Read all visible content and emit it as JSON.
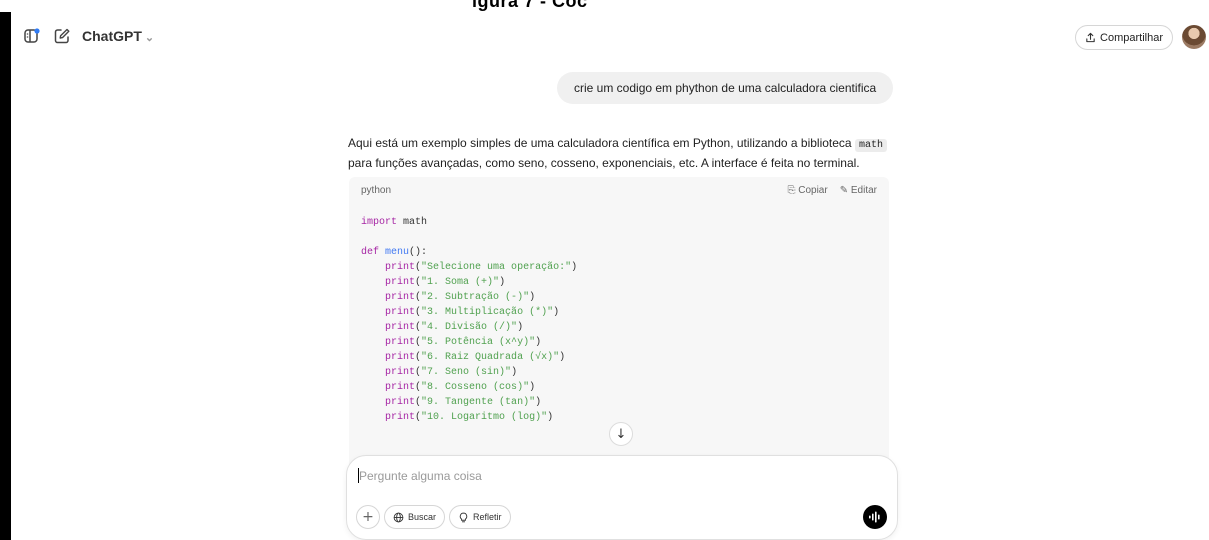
{
  "caption_fragment": "igura 7 - Cóc",
  "header": {
    "model_name": "ChatGPT",
    "share_label": "Compartilhar"
  },
  "conversation": {
    "user_message": "crie um codigo em phython de uma calculadora cientifica",
    "answer_part1": "Aqui está um exemplo simples de uma calculadora científica em Python, utilizando a biblioteca ",
    "answer_code": "math",
    "answer_part2": "para funções avançadas, como seno, cosseno, exponenciais, etc. A interface é feita no terminal."
  },
  "code_block": {
    "language": "python",
    "copy_label": "Copiar",
    "edit_label": "Editar",
    "lines": [
      "import math",
      "",
      "def menu():",
      "    print(\"Selecione uma operação:\")",
      "    print(\"1. Soma (+)\")",
      "    print(\"2. Subtração (-)\")",
      "    print(\"3. Multiplicação (*)\")",
      "    print(\"4. Divisão (/)\")",
      "    print(\"5. Potência (x^y)\")",
      "    print(\"6. Raiz Quadrada (√x)\")",
      "    print(\"7. Seno (sin)\")",
      "    print(\"8. Cosseno (cos)\")",
      "    print(\"9. Tangente (tan)\")",
      "    print(\"10. Logaritmo (log)\")"
    ]
  },
  "composer": {
    "placeholder": "Pergunte alguma coisa",
    "search_label": "Buscar",
    "think_label": "Refletir"
  },
  "icons": {
    "sidebar": "sidebar-toggle-icon",
    "new_chat": "new-chat-icon",
    "share": "share-upload-icon",
    "voice": "voice-wave-icon"
  }
}
